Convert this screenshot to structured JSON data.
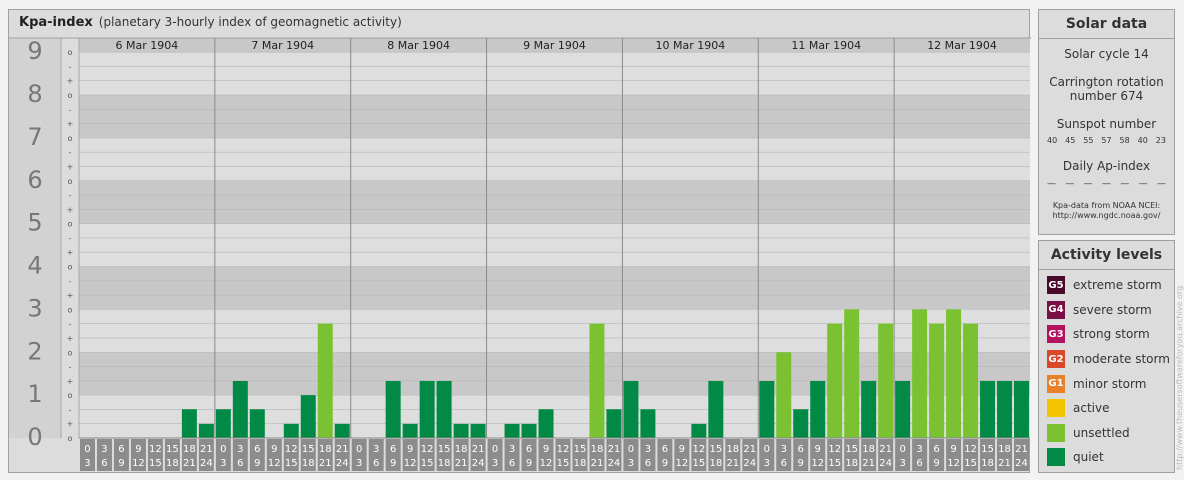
{
  "header": {
    "title": "Kpa-index",
    "subtitle": "(planetary 3-hourly index of geomagnetic activity)"
  },
  "solar": {
    "title": "Solar data",
    "cycle": "Solar cycle 14",
    "carrington_line1": "Carrington rotation",
    "carrington_line2": "number 674",
    "sunspot_label": "Sunspot number",
    "sunspots": [
      "40",
      "45",
      "55",
      "57",
      "58",
      "40",
      "23"
    ],
    "ap_label": "Daily Ap-index",
    "ap_values": [
      "—",
      "—",
      "—",
      "—",
      "—",
      "—",
      "—"
    ],
    "source_line1": "Kpa-data from NOAA NCEI:",
    "source_line2": "http://www.ngdc.noaa.gov/"
  },
  "levels": {
    "title": "Activity levels",
    "items": [
      {
        "code": "G5",
        "label": "extreme storm",
        "color": "#4a0a2a"
      },
      {
        "code": "G4",
        "label": "severe storm",
        "color": "#7a0f47"
      },
      {
        "code": "G3",
        "label": "strong storm",
        "color": "#b3125e"
      },
      {
        "code": "G2",
        "label": "moderate storm",
        "color": "#d9482b"
      },
      {
        "code": "G1",
        "label": "minor storm",
        "color": "#e8822a"
      },
      {
        "code": "",
        "label": "active",
        "color": "#f5c400"
      },
      {
        "code": "",
        "label": "unsettled",
        "color": "#7ac231"
      },
      {
        "code": "",
        "label": "quiet",
        "color": "#008a45"
      }
    ]
  },
  "credit": "http://www.theusersoftwareforyou.archive.org",
  "chart_data": {
    "type": "bar",
    "days": [
      "6 Mar 1904",
      "7 Mar 1904",
      "8 Mar 1904",
      "9 Mar 1904",
      "10 Mar 1904",
      "11 Mar 1904",
      "12 Mar 1904"
    ],
    "y_major_labels": [
      "0",
      "1",
      "2",
      "3",
      "4",
      "5",
      "6",
      "7",
      "8",
      "9"
    ],
    "y_minor_labels": [
      "o",
      "+",
      "-",
      "o"
    ],
    "ylim": [
      0,
      9.33
    ],
    "x_tick_top": [
      "0",
      "3",
      "6",
      "9",
      "12",
      "15",
      "18",
      "21"
    ],
    "x_tick_bottom": [
      "3",
      "6",
      "9",
      "12",
      "15",
      "18",
      "21",
      "24"
    ],
    "values": [
      [
        0,
        0,
        0,
        0,
        0,
        0,
        0.67,
        0.33
      ],
      [
        0.67,
        1.33,
        0.67,
        0,
        0.33,
        1,
        2.67,
        0.33
      ],
      [
        0,
        0,
        1.33,
        0.33,
        1.33,
        1.33,
        0.33,
        0.33
      ],
      [
        0,
        0.33,
        0.33,
        0.67,
        0,
        0,
        2.67,
        0.67
      ],
      [
        1.33,
        0.67,
        0,
        0,
        0.33,
        1.33,
        0,
        0
      ],
      [
        1.33,
        2,
        0.67,
        1.33,
        2.67,
        3,
        1.33,
        2.67
      ],
      [
        1.33,
        3,
        2.67,
        3,
        2.67,
        1.33,
        1.33,
        1.33
      ]
    ],
    "colors": {
      "quiet": "#008a45",
      "unsettled": "#7ac231"
    }
  }
}
